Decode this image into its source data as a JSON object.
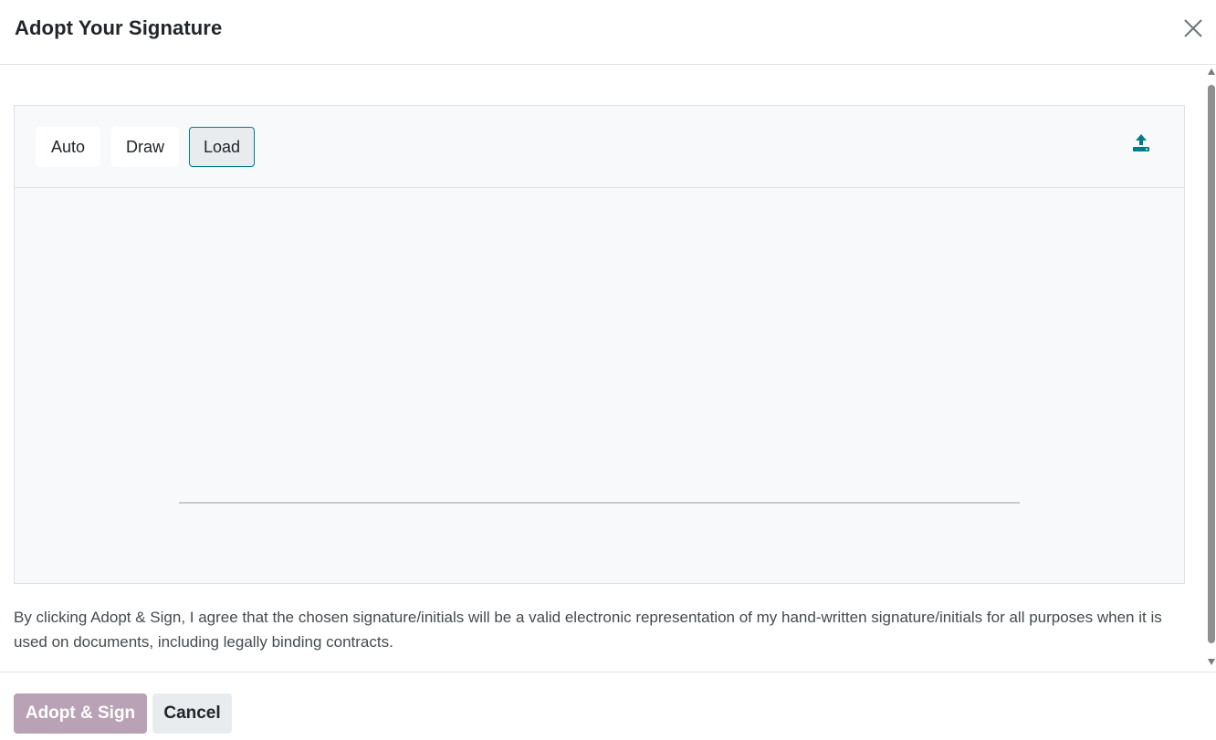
{
  "dialog": {
    "title": "Adopt Your Signature",
    "close_icon": "close-icon"
  },
  "signature": {
    "modes": [
      {
        "label": "Auto",
        "active": false
      },
      {
        "label": "Draw",
        "active": false
      },
      {
        "label": "Load",
        "active": true
      }
    ],
    "upload_icon": "upload-icon"
  },
  "legal_text": "By clicking Adopt & Sign, I agree that the chosen signature/initials will be a valid electronic representation of my hand-written signature/initials for all purposes when it is used on documents, including legally binding contracts.",
  "footer": {
    "adopt_label": "Adopt & Sign",
    "cancel_label": "Cancel"
  },
  "colors": {
    "accent": "#017e84",
    "primary_disabled": "#b9a2b5",
    "panel_bg": "#f8f9fa"
  }
}
